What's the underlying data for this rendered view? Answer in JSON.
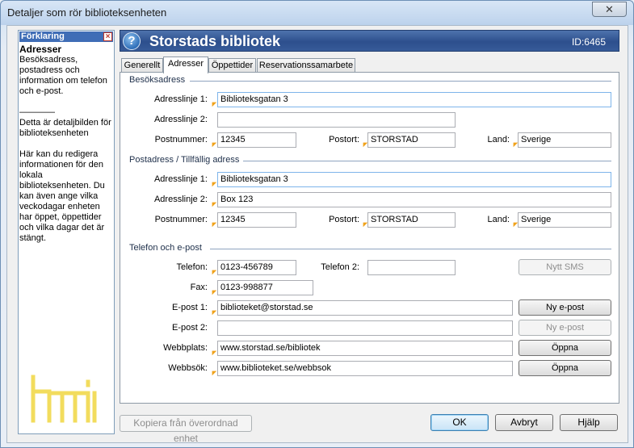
{
  "window": {
    "title": "Detaljer som rör biblioteksenheten",
    "close_glyph": "✕"
  },
  "explain": {
    "header": "Förklaring",
    "title": "Adresser",
    "text": "Besöksadress, postadress och information om telefon och e-post.\n\n————\nDetta är detaljbilden för biblioteksenheten\n\nHär kan du redigera informationen för den lokala biblioteksenheten. Du kan även ange vilka veckodagar enheten har öppet, öppettider och vilka dagar det är stängt."
  },
  "banner": {
    "name": "Storstads bibliotek",
    "id": "ID:6465",
    "icon": "help-icon"
  },
  "tabs": [
    "Generellt",
    "Adresser",
    "Öppettider",
    "Reservationssamarbete"
  ],
  "visit": {
    "heading": "Besöksadress",
    "addr1_label": "Adresslinje 1:",
    "addr1": "Biblioteksgatan 3",
    "addr2_label": "Adresslinje 2:",
    "addr2": "",
    "zip_label": "Postnummer:",
    "zip": "12345",
    "city_label": "Postort:",
    "city": "STORSTAD",
    "country_label": "Land:",
    "country": "Sverige"
  },
  "postal": {
    "heading": "Postadress / Tillfällig adress",
    "addr1_label": "Adresslinje 1:",
    "addr1": "Biblioteksgatan 3",
    "addr2_label": "Adresslinje 2:",
    "addr2": "Box 123",
    "zip_label": "Postnummer:",
    "zip": "12345",
    "city_label": "Postort:",
    "city": "STORSTAD",
    "country_label": "Land:",
    "country": "Sverige"
  },
  "contact": {
    "heading": "Telefon och e-post",
    "phone_label": "Telefon:",
    "phone": "0123-456789",
    "phone2_label": "Telefon 2:",
    "phone2": "",
    "sms_button": "Nytt SMS",
    "fax_label": "Fax:",
    "fax": "0123-998877",
    "email1_label": "E-post 1:",
    "email1": "biblioteket@storstad.se",
    "email1_button": "Ny e-post",
    "email2_label": "E-post 2:",
    "email2": "",
    "email2_button": "Ny e-post",
    "web_label": "Webbplats:",
    "web": "www.storstad.se/bibliotek",
    "web_button": "Öppna",
    "websearch_label": "Webbsök:",
    "websearch": "www.biblioteket.se/webbsok",
    "websearch_button": "Öppna"
  },
  "footer": {
    "copy_button": "Kopiera från överordnad enhet",
    "ok": "OK",
    "cancel": "Avbryt",
    "help": "Hjälp"
  },
  "colors": {
    "banner": "#2d4f8d",
    "accent_mark": "#f0a21b",
    "logo": "#f2dc5d"
  }
}
